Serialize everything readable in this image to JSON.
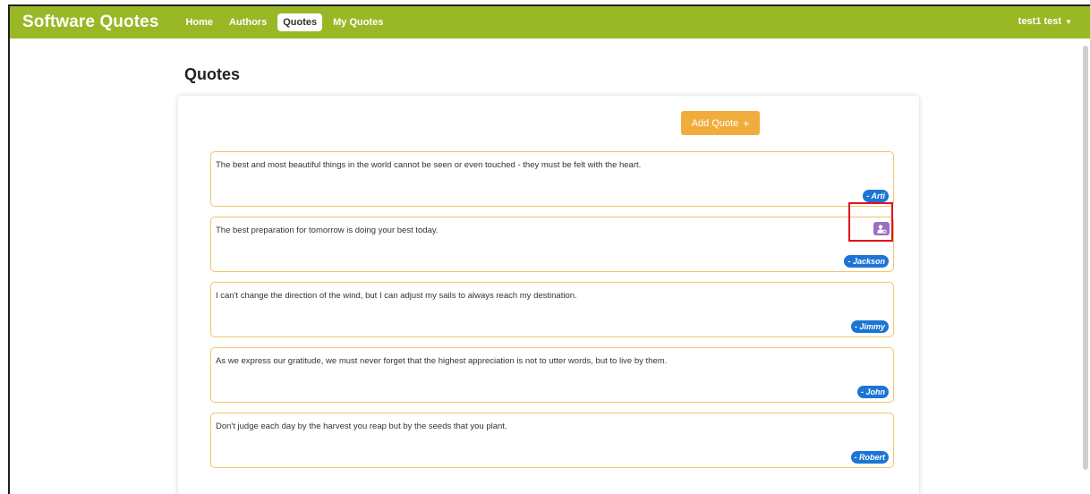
{
  "app": {
    "brand": "Software Quotes"
  },
  "nav": {
    "items": [
      {
        "label": "Home",
        "active": false
      },
      {
        "label": "Authors",
        "active": false
      },
      {
        "label": "Quotes",
        "active": true
      },
      {
        "label": "My Quotes",
        "active": false
      }
    ],
    "user": {
      "label": "test1 test"
    }
  },
  "page": {
    "title": "Quotes"
  },
  "actions": {
    "add_quote_label": "Add Quote",
    "add_icon": "+"
  },
  "quotes": [
    {
      "text": "The best and most beautiful things in the world cannot be seen or even touched - they must be felt with the heart.",
      "author": "- Arti"
    },
    {
      "text": "The best preparation for tomorrow is doing your best today.",
      "author": "- Jackson"
    },
    {
      "text": "I can't change the direction of the wind, but I can adjust my sails to always reach my destination.",
      "author": "- Jimmy"
    },
    {
      "text": "As we express our gratitude, we must never forget that the highest appreciation is not to utter words, but to live by them.",
      "author": "- John"
    },
    {
      "text": "Don't judge each day by the harvest you reap but by the seeds that you plant.",
      "author": "- Robert"
    }
  ],
  "colors": {
    "navbar": "#9ab726",
    "accent": "#f0ad3e",
    "author_badge": "#1c75d3",
    "icon_button": "#9a6fc4",
    "highlight": "#e0141e"
  },
  "icons": {
    "quote_action": "user-gear-icon",
    "user_caret": "caret-down-icon"
  }
}
